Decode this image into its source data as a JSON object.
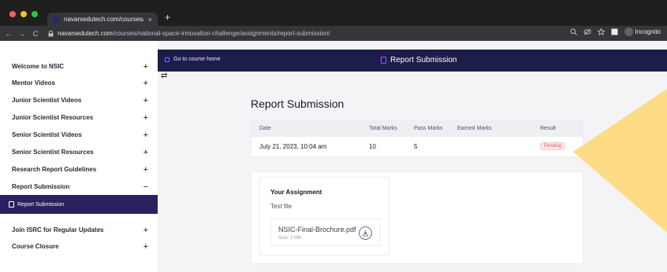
{
  "browser": {
    "tab_title": "navarsedutech.com/courses/n",
    "tab_close": "×",
    "new_tab": "+",
    "nav_back": "←",
    "nav_forward": "→",
    "nav_reload": "C",
    "url_host": "navarsedutech.com",
    "url_path": "/courses/national-space-innovation-challenge/assignments/report-submission/",
    "incognito": "Incognito",
    "colors": {
      "dot_red": "#ff5f57",
      "dot_yellow": "#febc2e",
      "dot_green": "#28c840"
    },
    "icons": [
      "lock-icon",
      "zoom-icon",
      "eye-off-icon",
      "star-icon",
      "sidebar-icon",
      "incognito-avatar-icon"
    ]
  },
  "sidebar": {
    "items": [
      {
        "label": "Welcome to NSIC",
        "sign": "+"
      },
      {
        "label": "Mentor Videos",
        "sign": "+"
      },
      {
        "label": "Junior Scientist Videos",
        "sign": "+"
      },
      {
        "label": "Junior Scientist Resources",
        "sign": "+"
      },
      {
        "label": "Senior Scientist Videos",
        "sign": "+"
      },
      {
        "label": "Senior Scientist Resources",
        "sign": "+"
      },
      {
        "label": "Research Report Guidelines",
        "sign": "+"
      },
      {
        "label": "Report Submission",
        "sign": "−"
      },
      {
        "label": "Join ISRC for Regular Updates",
        "sign": "+"
      },
      {
        "label": "Course Closure",
        "sign": "+"
      }
    ],
    "active_lesson": "Report Submission",
    "active_color": "#2c1f5f"
  },
  "topbar": {
    "go_home": "Go to course home",
    "title": "Report Submission",
    "swap_icon": "⇄",
    "color": "#1c1d4d"
  },
  "main": {
    "heading": "Report Submission",
    "table": {
      "headers": [
        "Date",
        "Total Marks",
        "Pass Marks",
        "Earned Marks",
        "Result"
      ],
      "row": {
        "date": "July 21, 2023, 10:04 am",
        "total": "10",
        "pass": "5",
        "earned": "",
        "result": "Pending"
      }
    },
    "assignment": {
      "title": "Your Assignment",
      "text": "Test file",
      "file_name": "NSIC-Final-Brochure.pdf",
      "file_size": "Size: 3 MB"
    }
  },
  "decoration": {
    "triangle_color": "#fddc85"
  }
}
